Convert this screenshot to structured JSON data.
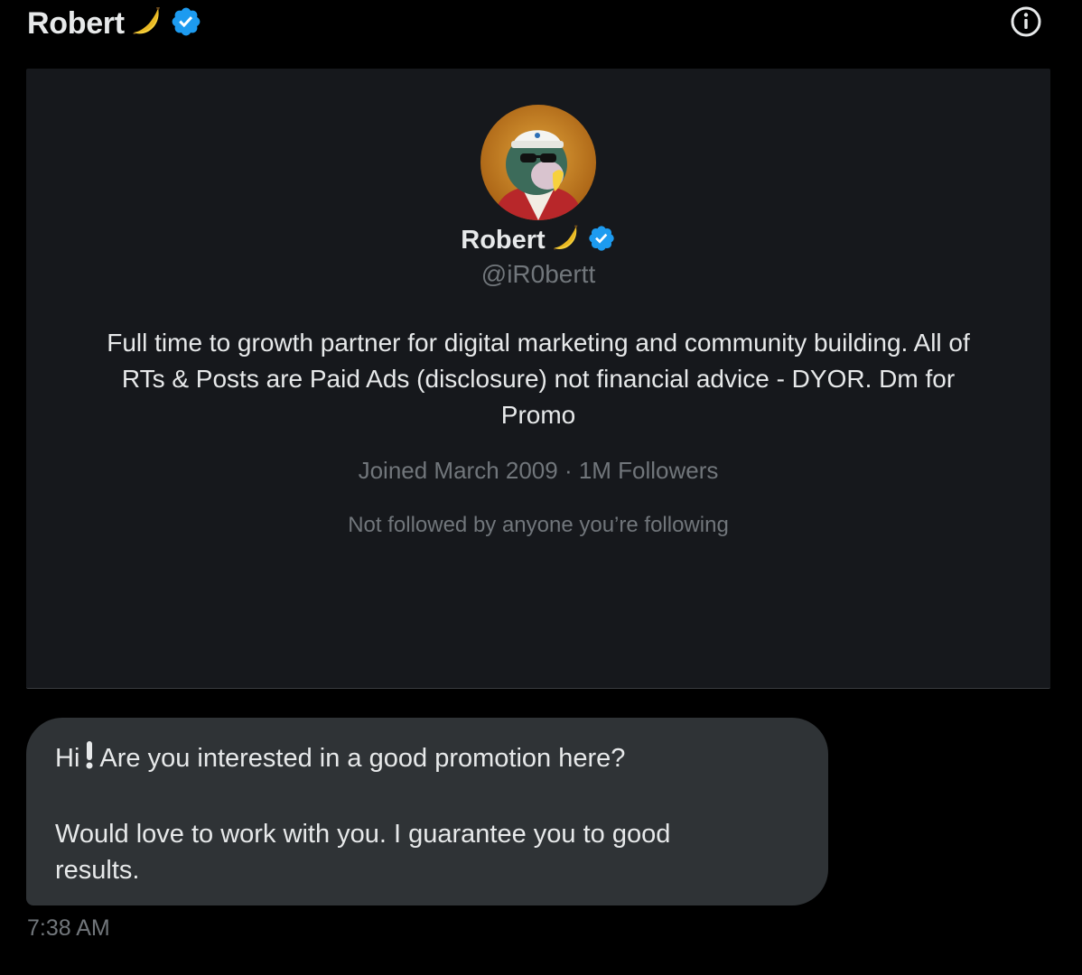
{
  "header": {
    "name": "Robert",
    "name_emoji": "banana-icon",
    "verified_icon": "verified-badge-icon",
    "info_icon": "info-icon"
  },
  "profile": {
    "avatar": "avatar",
    "name": "Robert",
    "handle": "@iR0bertt",
    "bio_lines": [
      "Full time to growth partner for digital marketing and community building. All of",
      "RTs & Posts are Paid Ads (disclosure) not financial advice - DYOR. Dm for",
      "Promo"
    ],
    "meta": "Joined March 2009 · 1M Followers",
    "follow_note": "Not followed by anyone you’re following"
  },
  "message": {
    "greeting": "Hi",
    "greeting_icon": "exclamation-icon",
    "line1_rest": "Are you interested in a good promotion here?",
    "line2": "Would love to work with you. I guarantee you to good",
    "line3": "results.",
    "timestamp": "7:38 AM"
  },
  "colors": {
    "background": "#000000",
    "card": "#16181c",
    "bubble": "#2f3336",
    "text": "#e7e9ea",
    "muted": "#71767b",
    "verified": "#1d9bf0"
  }
}
